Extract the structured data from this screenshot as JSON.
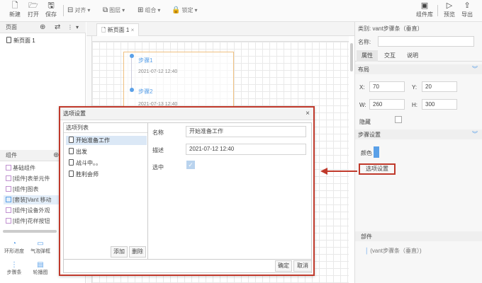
{
  "toolbar": {
    "new": "新建",
    "open": "打开",
    "save": "保存",
    "align": "对齐",
    "layer": "图层",
    "group": "组合",
    "lock": "锁定",
    "component_lib": "组件库",
    "preview": "预览",
    "export": "导出"
  },
  "pages_panel": {
    "title": "页面",
    "items": [
      "新页面 1"
    ]
  },
  "components_panel": {
    "title": "组件",
    "items": [
      "基础组件",
      "[组件]表单元件",
      "[组件]图表",
      "[套装]Vant 移动",
      "[组件]设备外观",
      "[组件]花样按钮"
    ],
    "bottom_icons": [
      "环形进度",
      "气泡弹框",
      "步骤条",
      "轮播图"
    ]
  },
  "canvas": {
    "tab": "新页面 1",
    "steps": [
      {
        "title": "步骤1",
        "time": "2021-07-12 12:40"
      },
      {
        "title": "步骤2",
        "time": "2021-07-13 12:40"
      }
    ]
  },
  "right_panel": {
    "category": "类别: vant步骤条（垂直）",
    "name_label": "名称:",
    "tabs": [
      "属性",
      "交互",
      "说明"
    ],
    "layout_title": "布局",
    "x_label": "X:",
    "x_value": "70",
    "y_label": "Y:",
    "y_value": "20",
    "w_label": "W:",
    "w_value": "260",
    "h_label": "H:",
    "h_value": "300",
    "hidden_label": "隐藏",
    "steps_settings_title": "步骤设置",
    "color_label": "颜色",
    "option_button": "选项设置",
    "parts_title": "部件",
    "parts_item": "(vant步骤条（垂直）)",
    "accent": "#5aa0e8"
  },
  "dialog": {
    "title": "选项设置",
    "close": "×",
    "list_title": "选项列表",
    "list_items": [
      "开始准备工作",
      "出发",
      "战斗中。。",
      "胜利会师"
    ],
    "add_button": "添加",
    "delete_button": "删除",
    "name_label": "名称",
    "name_value": "开始准备工作",
    "desc_label": "描述",
    "desc_value": "2021-07-12 12:40",
    "checked_label": "选中",
    "ok_button": "确定",
    "cancel_button": "取消",
    "highlight": "#c0392b"
  }
}
